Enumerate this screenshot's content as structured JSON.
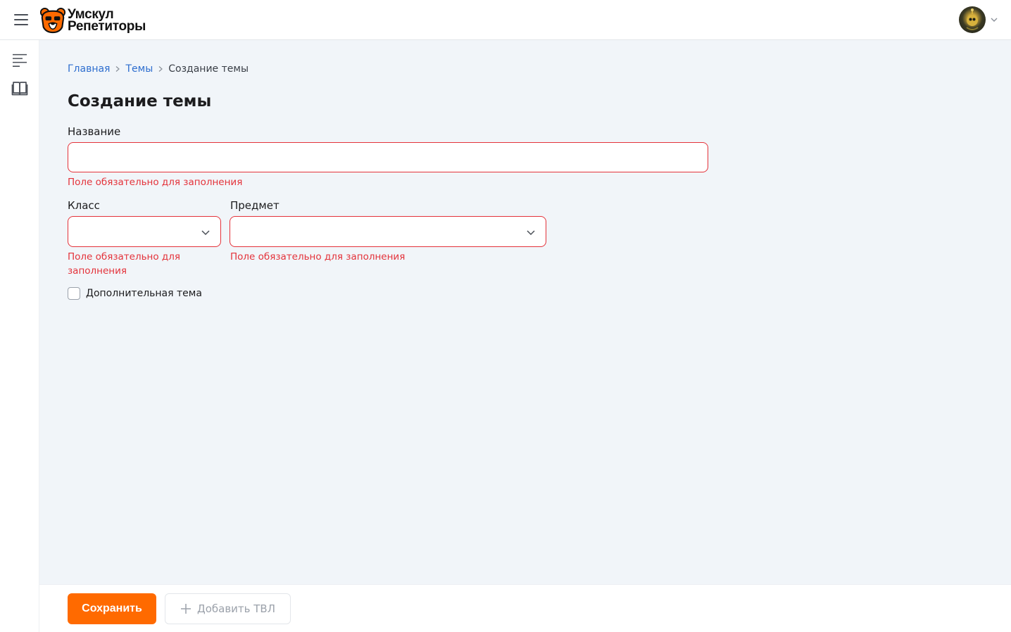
{
  "brand": {
    "line1": "Умскул",
    "line2": "Репетиторы",
    "accent": "#ff6a00"
  },
  "icons": {
    "menu": "hamburger-menu-icon",
    "profile_chevron": "chevron-down-icon",
    "sidebar_list": "list-icon",
    "sidebar_book": "book-icon",
    "breadcrumb_sep": "chevron-right-icon",
    "add": "plus-icon"
  },
  "breadcrumb": [
    {
      "label": "Главная"
    },
    {
      "label": "Темы"
    },
    {
      "label": "Создание темы"
    }
  ],
  "page": {
    "title": "Создание темы"
  },
  "form": {
    "name": {
      "label": "Название",
      "value": "",
      "error": "Поле обязательно для заполнения"
    },
    "grade": {
      "label": "Класс",
      "value": "",
      "error": "Поле обязательно для заполнения"
    },
    "subject": {
      "label": "Предмет",
      "value": "",
      "error": "Поле обязательно для заполнения"
    },
    "extra": {
      "label": "Дополнительная тема",
      "checked": false
    }
  },
  "footer": {
    "save_label": "Сохранить",
    "add_label": "Добавить ТВЛ"
  },
  "colors": {
    "error": "#e4323a",
    "link": "#2e6ecf",
    "background": "#f1f5f9"
  }
}
